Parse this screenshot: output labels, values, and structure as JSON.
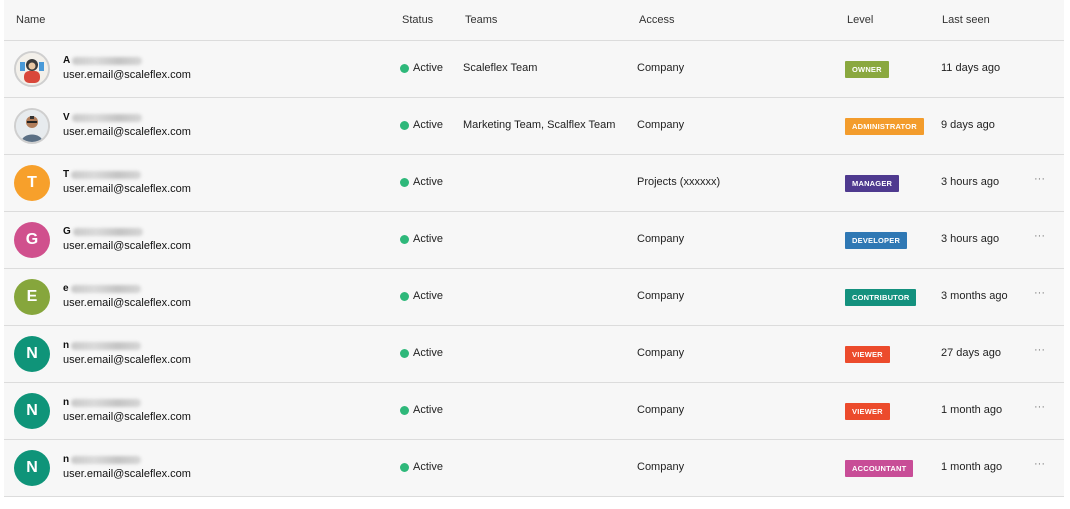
{
  "table": {
    "headers": {
      "name": "Name",
      "status": "Status",
      "teams": "Teams",
      "access": "Access",
      "level": "Level",
      "last_seen": "Last seen"
    },
    "rows": [
      {
        "avatar_type": "photo",
        "avatar_icon": "user-photo-avatar",
        "name_initial": "A",
        "email": "user.email@scaleflex.com",
        "status": "Active",
        "teams": "Scaleflex Team",
        "access": "Company",
        "level": "OWNER",
        "level_color": "#8aa83f",
        "last_seen": "11 days ago",
        "has_more_menu": false
      },
      {
        "avatar_type": "photo",
        "avatar_icon": "user-photo-avatar",
        "name_initial": "V",
        "email": "user.email@scaleflex.com",
        "status": "Active",
        "teams": "Marketing Team, Scalflex Team",
        "access": "Company",
        "level": "ADMINISTRATOR",
        "level_color": "#f39c2c",
        "last_seen": "9 days ago",
        "has_more_menu": false
      },
      {
        "avatar_type": "letter",
        "avatar_letter": "T",
        "avatar_color": "#f7a02b",
        "name_initial": "T",
        "email": "user.email@scaleflex.com",
        "status": "Active",
        "teams": "",
        "access": "Projects (xxxxxx)",
        "level": "MANAGER",
        "level_color": "#4f3a8f",
        "last_seen": "3 hours ago",
        "has_more_menu": true
      },
      {
        "avatar_type": "letter",
        "avatar_letter": "G",
        "avatar_color": "#d0508d",
        "name_initial": "G",
        "email": "user.email@scaleflex.com",
        "status": "Active",
        "teams": "",
        "access": "Company",
        "level": "DEVELOPER",
        "level_color": "#2f78b4",
        "last_seen": "3 hours ago",
        "has_more_menu": true
      },
      {
        "avatar_type": "letter",
        "avatar_letter": "E",
        "avatar_color": "#86a63c",
        "name_initial": "e",
        "email": "user.email@scaleflex.com",
        "status": "Active",
        "teams": "",
        "access": "Company",
        "level": "CONTRIBUTOR",
        "level_color": "#14917e",
        "last_seen": "3 months ago",
        "has_more_menu": true
      },
      {
        "avatar_type": "letter",
        "avatar_letter": "N",
        "avatar_color": "#0f9479",
        "name_initial": "n",
        "email": "user.email@scaleflex.com",
        "status": "Active",
        "teams": "",
        "access": "Company",
        "level": "VIEWER",
        "level_color": "#ec4b2c",
        "last_seen": "27 days ago",
        "has_more_menu": true
      },
      {
        "avatar_type": "letter",
        "avatar_letter": "N",
        "avatar_color": "#0f9479",
        "name_initial": "n",
        "email": "user.email@scaleflex.com",
        "status": "Active",
        "teams": "",
        "access": "Company",
        "level": "VIEWER",
        "level_color": "#ec4b2c",
        "last_seen": "1 month ago",
        "has_more_menu": true
      },
      {
        "avatar_type": "letter",
        "avatar_letter": "N",
        "avatar_color": "#0f9479",
        "name_initial": "n",
        "email": "user.email@scaleflex.com",
        "status": "Active",
        "teams": "",
        "access": "Company",
        "level": "ACCOUNTANT",
        "level_color": "#c84d97",
        "last_seen": "1 month ago",
        "has_more_menu": true
      }
    ],
    "more_menu_label": "···",
    "status_dot_color": "#2eb87a"
  }
}
